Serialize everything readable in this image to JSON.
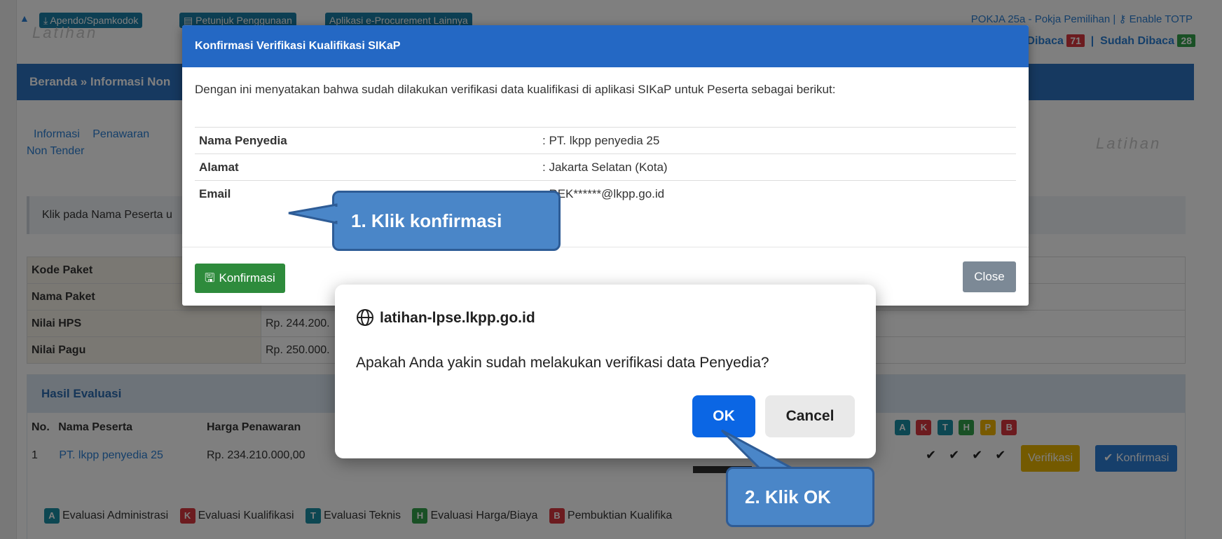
{
  "topbar": {
    "links": [
      "Apendo/Spamkodok",
      "Petunjuk Penggunaan",
      "Aplikasi e-Procurement Lainnya"
    ],
    "user": "POKJA 25a",
    "role": "Pokja Pemilihan",
    "totp": "Enable TOTP",
    "belum_dibaca": "Dibaca",
    "belum_count": "71",
    "sudah_dibaca": "Sudah Dibaca",
    "sudah_count": "28",
    "watermark": "Latihan"
  },
  "breadcrumb": "Beranda » Informasi Non",
  "tabs": {
    "informasi": "Informasi",
    "penawaran": "Penawaran",
    "non_tender": "Non Tender"
  },
  "info_text": "Klik pada Nama Peserta u",
  "paket": [
    {
      "key": "Kode Paket",
      "value": ""
    },
    {
      "key": "Nama Paket",
      "value": ""
    },
    {
      "key": "Nilai HPS",
      "value": "Rp. 244.200."
    },
    {
      "key": "Nilai Pagu",
      "value": "Rp. 250.000."
    }
  ],
  "hasil": {
    "title": "Hasil Evaluasi",
    "col_no": "No.",
    "col_nama": "Nama Peserta",
    "col_harga": "Harga Penawaran",
    "row_no": "1",
    "row_nama": "PT. lkpp penyedia 25",
    "row_harga": "Rp. 234.210.000,00",
    "badges": [
      "A",
      "K",
      "T",
      "H",
      "P",
      "B"
    ],
    "checks": "✔✔✔✔",
    "verifikasi": "Verifikasi",
    "konfirmasi": "Konfirmasi"
  },
  "legend": [
    {
      "badge": "A",
      "label": "Evaluasi Administrasi"
    },
    {
      "badge": "K",
      "label": "Evaluasi Kualifikasi"
    },
    {
      "badge": "T",
      "label": "Evaluasi Teknis"
    },
    {
      "badge": "H",
      "label": "Evaluasi Harga/Biaya"
    },
    {
      "badge": "B",
      "label": "Pembuktian Kualifika"
    }
  ],
  "modal": {
    "title": "Konfirmasi Verifikasi Kualifikasi SIKaP",
    "intro": "Dengan ini menyatakan bahwa sudah dilakukan verifikasi data kualifikasi di aplikasi SIKaP untuk Peserta sebagai berikut:",
    "rows": [
      {
        "key": "Nama Penyedia",
        "value": ": PT. lkpp penyedia 25"
      },
      {
        "key": "Alamat",
        "value": ": Jakarta Selatan (Kota)"
      },
      {
        "key": "Email",
        "value": ": REK******@lkpp.go.id"
      }
    ],
    "konfirmasi_button": "Konfirmasi",
    "close_button": "Close"
  },
  "dialog": {
    "origin": "latihan-lpse.lkpp.go.id",
    "message": "Apakah Anda yakin sudah melakukan verifikasi data Penyedia?",
    "ok": "OK",
    "cancel": "Cancel"
  },
  "callouts": {
    "step1": "1. Klik konfirmasi",
    "step2": "2. Klik OK"
  },
  "colors": {
    "modal_header": "#2468c4",
    "ok_button": "#0b66e4",
    "callout_fill": "#4a86c8",
    "konfirmasi_green": "#2e8b3c"
  }
}
